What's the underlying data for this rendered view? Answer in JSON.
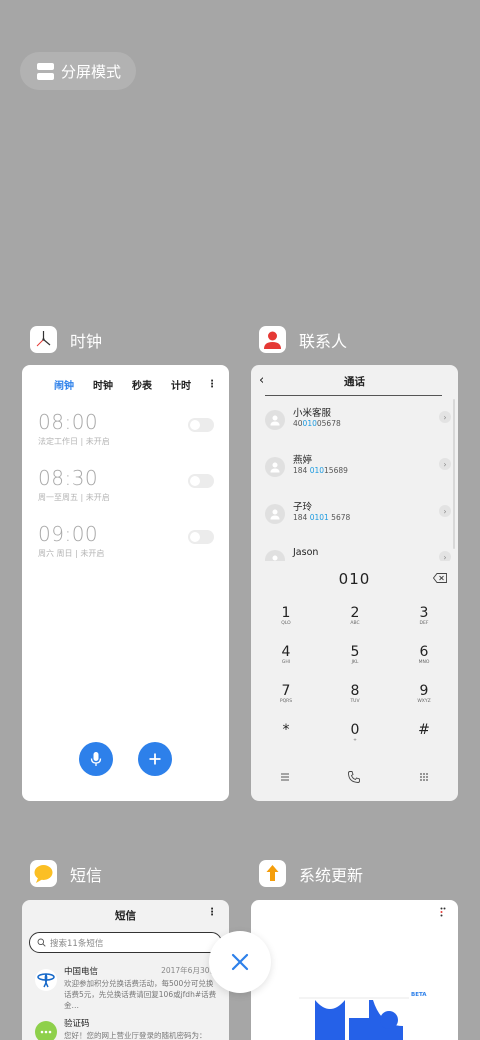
{
  "split_screen": {
    "label": "分屏模式"
  },
  "apps": {
    "clock": {
      "name": "时钟"
    },
    "contacts": {
      "name": "联系人"
    },
    "sms": {
      "name": "短信"
    },
    "update": {
      "name": "系统更新"
    }
  },
  "clock": {
    "tabs": [
      "闹钟",
      "时钟",
      "秒表",
      "计时"
    ],
    "active_tab": "闹钟",
    "alarms": [
      {
        "time": "08:00",
        "sub": "法定工作日 | 未开启",
        "enabled": false
      },
      {
        "time": "08:30",
        "sub": "周一至周五 | 未开启",
        "enabled": false
      },
      {
        "time": "09:00",
        "sub": "周六 周日 | 未开启",
        "enabled": false
      }
    ],
    "accent": "#2d80ea"
  },
  "contacts": {
    "title": "通话",
    "items": [
      {
        "name": "小米客服",
        "num_pre": "40",
        "num_hl": "010",
        "num_post": "05678"
      },
      {
        "name": "燕婷",
        "num_pre": "184 ",
        "num_hl": "010",
        "num_post": "15689"
      },
      {
        "name": "子玲",
        "num_pre": "184 ",
        "num_hl": "0101",
        "num_post": " 5678"
      },
      {
        "name": "Jason",
        "num_pre": "",
        "num_hl": "",
        "num_post": ""
      }
    ],
    "dialed": "010",
    "keys": [
      {
        "d": "1",
        "l": "QLO"
      },
      {
        "d": "2",
        "l": "ABC"
      },
      {
        "d": "3",
        "l": "DEF"
      },
      {
        "d": "4",
        "l": "GHI"
      },
      {
        "d": "5",
        "l": "JKL"
      },
      {
        "d": "6",
        "l": "MNO"
      },
      {
        "d": "7",
        "l": "PQRS"
      },
      {
        "d": "8",
        "l": "TUV"
      },
      {
        "d": "9",
        "l": "WXYZ"
      },
      {
        "d": "*",
        "l": ""
      },
      {
        "d": "0",
        "l": "+"
      },
      {
        "d": "#",
        "l": ""
      }
    ],
    "highlight": "#1d9be0"
  },
  "sms": {
    "title": "短信",
    "search_placeholder": "搜索11条短信",
    "messages": [
      {
        "sender": "中国电信",
        "date": "2017年6月30日",
        "text": "欢迎参加积分兑换话费活动，每500分可兑换话费5元，先兑换话费请回复106或jfdh#话费金…",
        "avatar_color": "#ffffff"
      },
      {
        "sender": "验证码",
        "date": "",
        "text": "您好！您的网上营业厅登录的随机密码为：",
        "avatar_color": "#8ed04b"
      }
    ]
  },
  "update": {
    "badge": "BETA"
  }
}
